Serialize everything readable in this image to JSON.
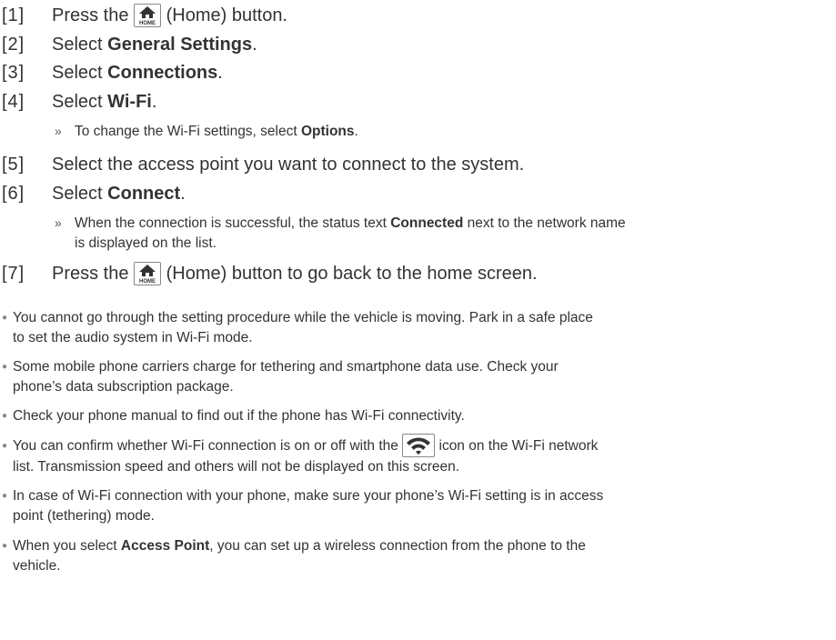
{
  "steps": [
    {
      "num": "[1]",
      "pre": "Press the ",
      "post": " (Home) button."
    },
    {
      "num": "[2]",
      "pre": "Select ",
      "bold": "General Settings",
      "post": "."
    },
    {
      "num": "[3]",
      "pre": "Select ",
      "bold": "Connections",
      "post": "."
    },
    {
      "num": "[4]",
      "pre": "Select ",
      "bold": "Wi-Fi",
      "post": "."
    },
    {
      "num": "[5]",
      "text": "Select the access point you want to connect to the system."
    },
    {
      "num": "[6]",
      "pre": "Select ",
      "bold": "Connect",
      "post": "."
    },
    {
      "num": "[7]",
      "pre": "Press the ",
      "post": " (Home) button to go back to the home screen."
    }
  ],
  "notes": {
    "step4": {
      "pre": "To change the Wi-Fi settings, select ",
      "bold": "Options",
      "post": "."
    },
    "step6": {
      "pre": "When the connection is successful, the status text ",
      "bold": "Connected",
      "post": " next to the network name",
      "line2": "is displayed on the list."
    }
  },
  "arrow_glyph": "»",
  "bullet_glyph": "●",
  "bullets": [
    {
      "line1": "You cannot go through the setting procedure while the vehicle is moving. Park in a safe place",
      "line2": "to set the audio system in Wi-Fi mode."
    },
    {
      "line1": "Some mobile phone carriers charge for tethering and smartphone data use. Check your",
      "line2": "phone’s data subscription package."
    },
    {
      "line1": "Check your phone manual to find out if the phone has Wi-Fi connectivity."
    },
    {
      "pre": "You can confirm whether Wi-Fi connection is on or off with the ",
      "post": " icon on the Wi-Fi network",
      "line2": "list. Transmission speed and others will not be displayed on this screen."
    },
    {
      "line1": "In case of Wi-Fi connection with your phone, make sure your phone’s Wi-Fi setting is in access",
      "line2": "point (tethering) mode."
    },
    {
      "pre": "When you select ",
      "bold": "Access Point",
      "post": ", you can set up a wireless connection from the phone to the",
      "line2": "vehicle."
    }
  ],
  "icons": {
    "home": "home-icon",
    "wifi": "wifi-icon",
    "home_label": "HOME"
  },
  "colors": {
    "text": "#333333",
    "icon_fill": "#333333"
  }
}
